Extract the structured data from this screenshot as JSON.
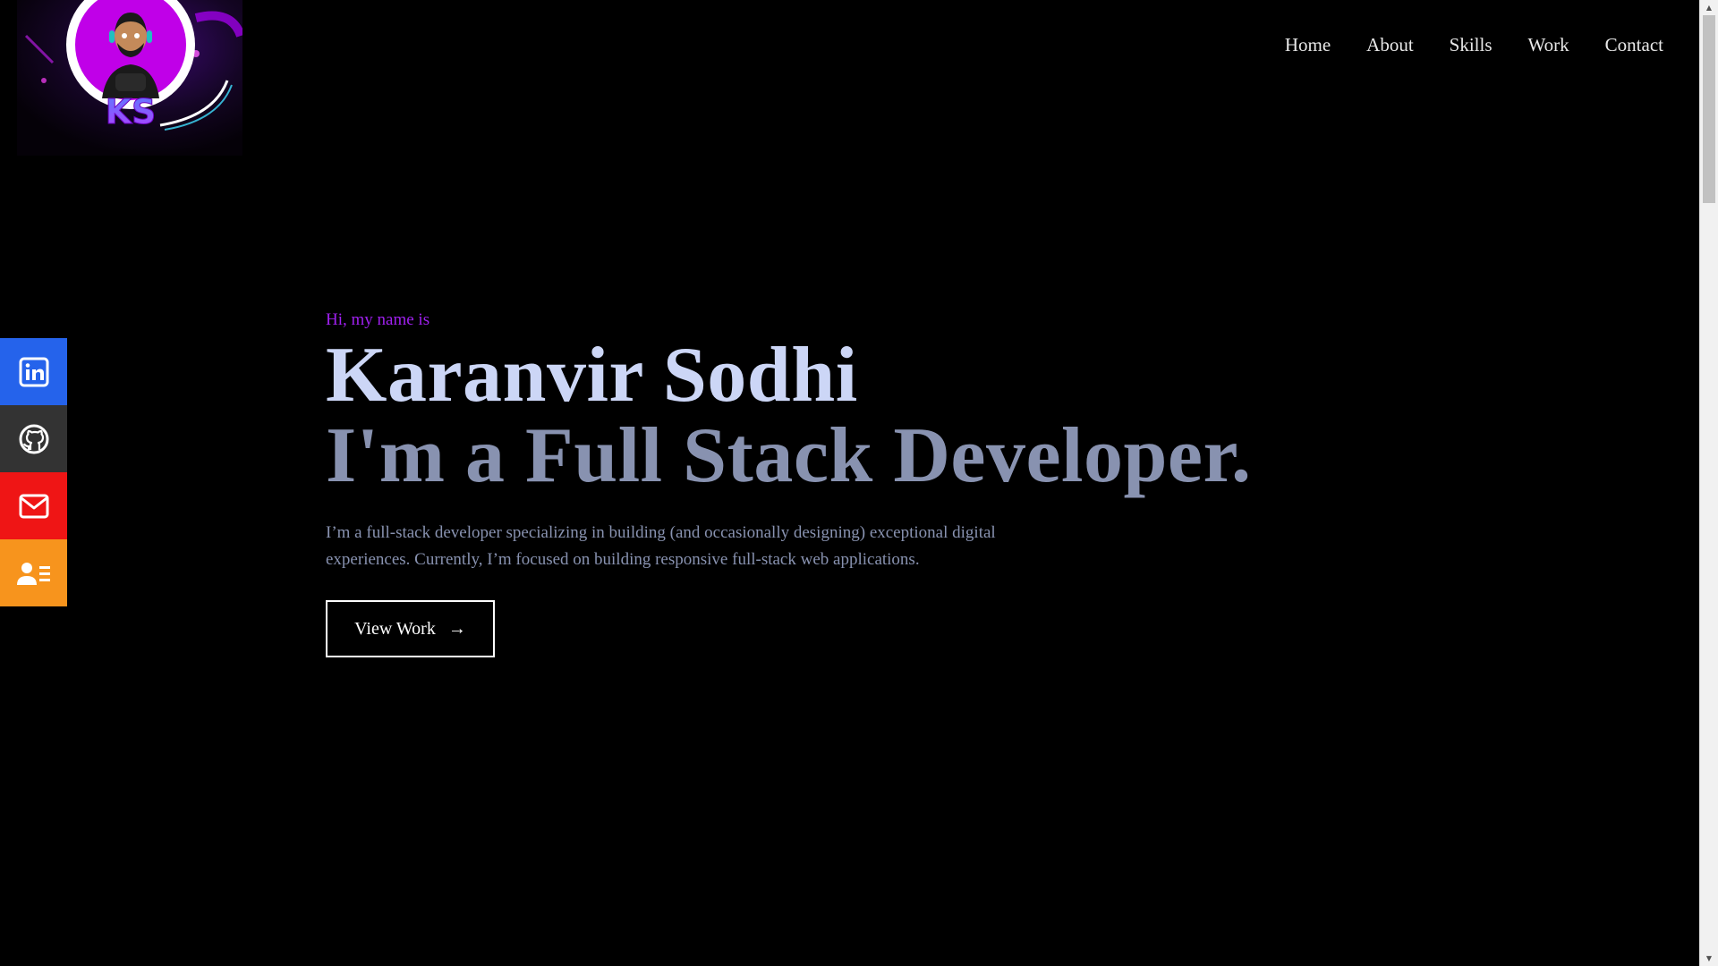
{
  "logo": {
    "text": "KS",
    "alt": "avatar-logo"
  },
  "nav": {
    "items": [
      {
        "label": "Home"
      },
      {
        "label": "About"
      },
      {
        "label": "Skills"
      },
      {
        "label": "Work"
      },
      {
        "label": "Contact"
      }
    ]
  },
  "social": {
    "items": [
      {
        "icon": "linkedin-icon",
        "color": "#2563eb"
      },
      {
        "icon": "github-icon",
        "color": "#333333"
      },
      {
        "icon": "mail-icon",
        "color": "#ef1515"
      },
      {
        "icon": "resume-icon",
        "color": "#f7941d"
      }
    ]
  },
  "hero": {
    "intro": "Hi, my name is",
    "name": "Karanvir Sodhi",
    "tagline": "I'm a Full Stack Developer.",
    "description": "I’m a full-stack developer specializing in building (and occasionally designing) exceptional digital experiences. Currently, I’m focused on building responsive full-stack web applications.",
    "cta_label": "View Work",
    "cta_arrow": "→"
  },
  "colors": {
    "background": "#000000",
    "accent": "#a020f0",
    "name": "#ccd6f6",
    "muted": "#8892b0"
  }
}
